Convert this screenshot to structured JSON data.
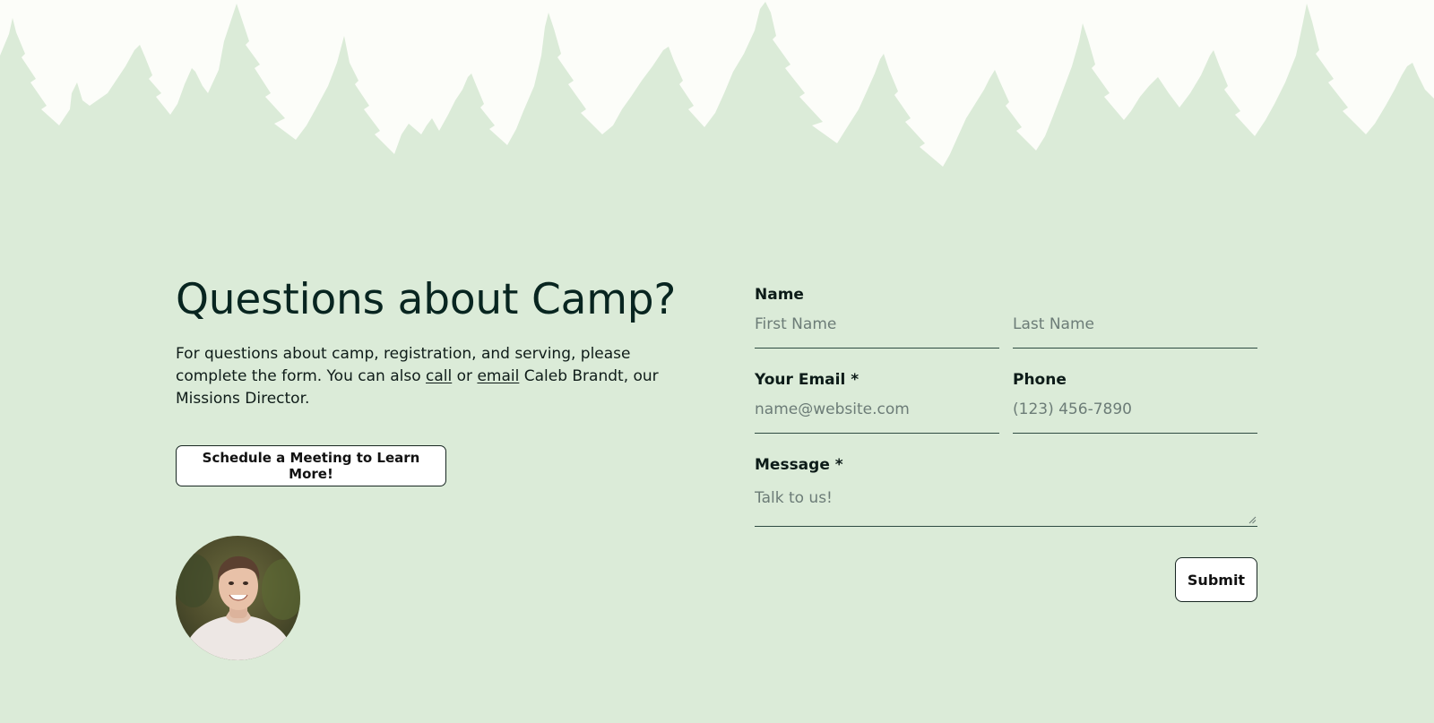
{
  "theme": {
    "background": "#dbebd8",
    "tree_band_light": "#fcfdf9",
    "tree_color": "#dbebd8",
    "heading_color": "#082520",
    "button_bg": "#ffffff"
  },
  "section": {
    "title": "Questions about Camp?",
    "intro_before_call": "For questions about camp, registration, and serving, please complete the form. You can also ",
    "call_link": "call",
    "intro_between": " or ",
    "email_link": "email",
    "intro_after": " Caleb Brandt, our Missions Director.",
    "schedule_button": "Schedule a Meeting to Learn More!"
  },
  "contact_person": {
    "avatar_icon": "person-photo"
  },
  "form": {
    "name_label": "Name",
    "first_name_placeholder": "First Name",
    "last_name_placeholder": "Last Name",
    "email_label": "Your Email *",
    "email_placeholder": "name@website.com",
    "phone_label": "Phone",
    "phone_placeholder": "(123) 456-7890",
    "message_label": "Message *",
    "message_placeholder": "Talk to us!",
    "submit_label": "Submit"
  }
}
